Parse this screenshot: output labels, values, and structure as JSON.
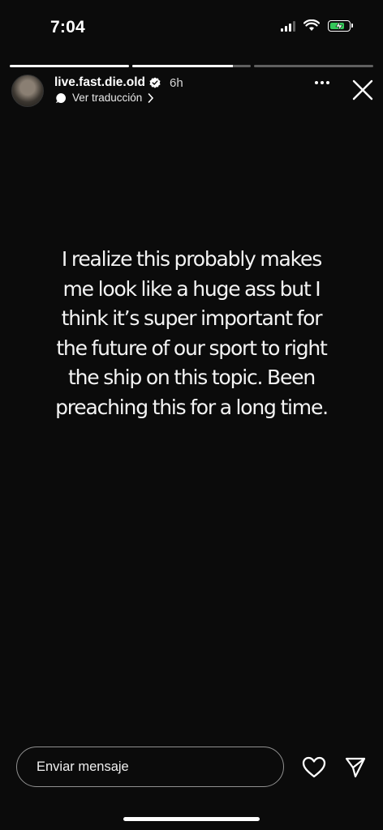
{
  "status_bar": {
    "time": "7:04"
  },
  "story": {
    "progress": [
      1.0,
      0.85,
      0.0
    ],
    "username": "live.fast.die.old",
    "time_ago": "6h",
    "translate_label": "Ver traducción",
    "text": "I realize this probably makes me look like a huge ass but I think it’s super important for the future of our sport to right the ship on this topic. Been preaching this for a long time."
  },
  "reply": {
    "placeholder": "Enviar mensaje"
  },
  "colors": {
    "background": "#0b0b0b",
    "battery": "#34c759",
    "verified": "#3897f0"
  },
  "icons": [
    "signal-icon",
    "wifi-icon",
    "battery-icon",
    "verified-icon",
    "translate-icon",
    "chevron-right-icon",
    "more-icon",
    "close-icon",
    "heart-icon",
    "send-icon"
  ]
}
